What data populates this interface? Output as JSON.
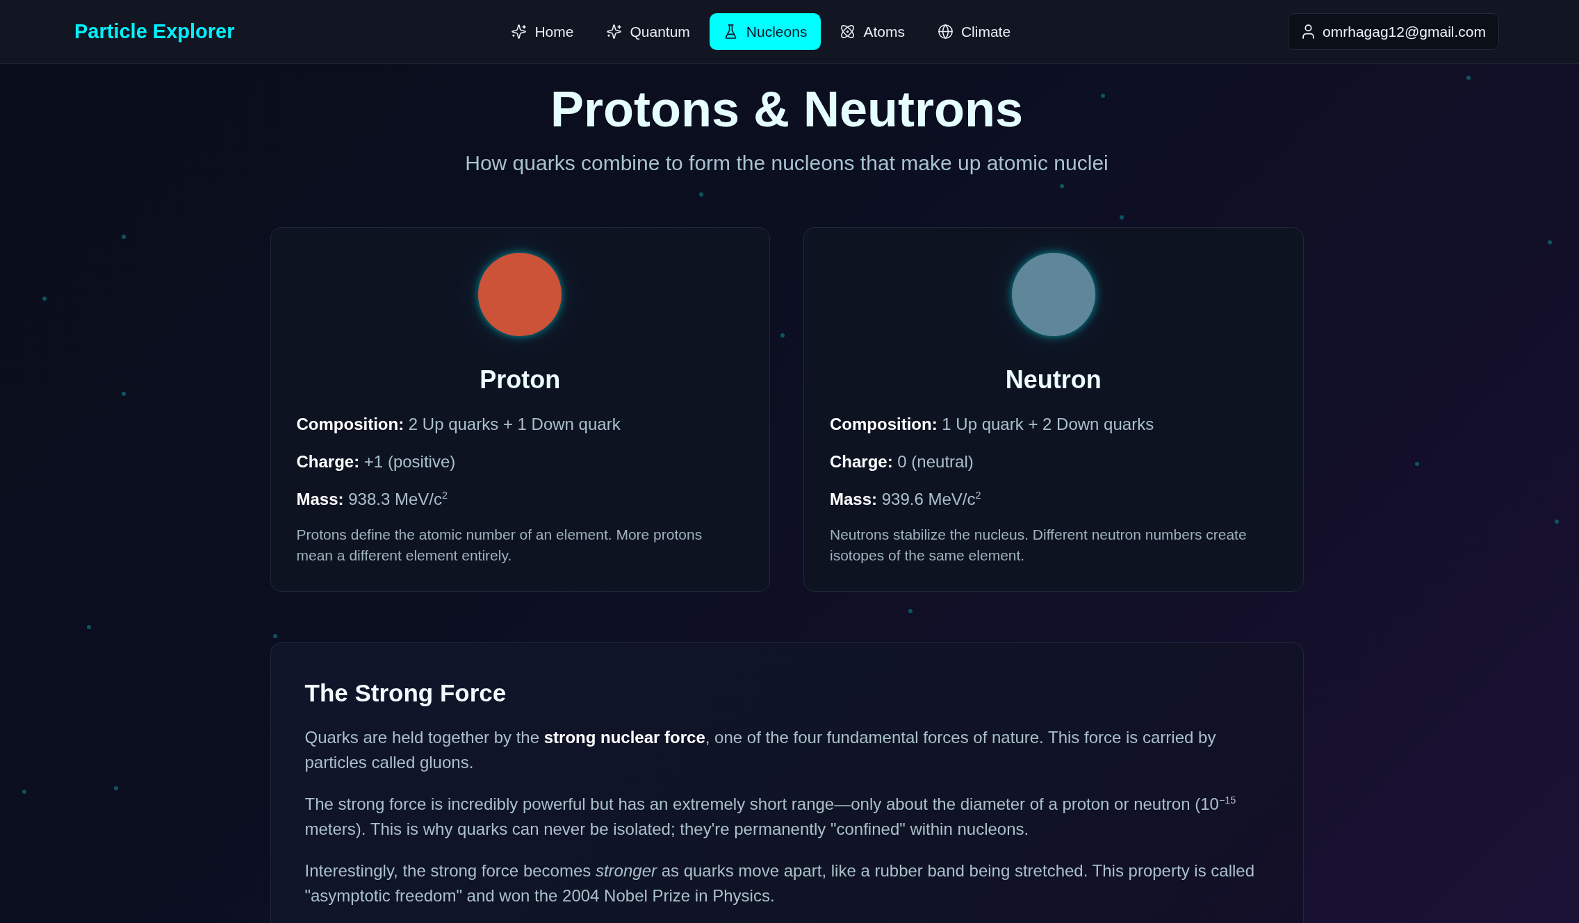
{
  "header": {
    "logo": "Particle Explorer",
    "nav": [
      {
        "label": "Home",
        "selected": false
      },
      {
        "label": "Quantum",
        "selected": false
      },
      {
        "label": "Nucleons",
        "selected": true
      },
      {
        "label": "Atoms",
        "selected": false
      },
      {
        "label": "Climate",
        "selected": false
      }
    ],
    "account": {
      "email": "omrhagag12@gmail.com"
    }
  },
  "page": {
    "title": "Protons & Neutrons",
    "subtitle": "How quarks combine to form the nucleons that make up atomic nuclei"
  },
  "particles": [
    {
      "name": "Proton",
      "color": "#cc5238",
      "properties": [
        "**Composition:** 2 Up quarks + 1 Down quark",
        "**Charge:** +1 (positive)",
        "**Mass:** 938.3 MeV/c$^{2}$"
      ],
      "description": "Protons define the atomic number of an element. More protons mean a different element entirely."
    },
    {
      "name": "Neutron",
      "color": "#5f8799",
      "properties": [
        "**Composition:** 1 Up quark + 2 Down quarks",
        "**Charge:** 0 (neutral)",
        "**Mass:** 939.6 MeV/c$^{2}$"
      ],
      "description": "Neutrons stabilize the nucleus. Different neutron numbers create isotopes of the same element."
    }
  ],
  "section": {
    "heading": "The Strong Force",
    "paragraphs": [
      "Quarks are held together by the **strong nuclear force**, one of the four fundamental forces of nature. This force is carried by particles called gluons.",
      "The strong force is incredibly powerful but has an extremely short range—only about the diameter of a proton or neutron (10$^{−15}$ meters). This is why quarks can never be isolated; they're permanently \"confined\" within nucleons.",
      "Interestingly, the strong force becomes *stronger* as quarks move apart, like a rubber band being stretched. This property is called \"asymptotic freedom\" and won the 2004 Nobel Prize in Physics."
    ]
  }
}
